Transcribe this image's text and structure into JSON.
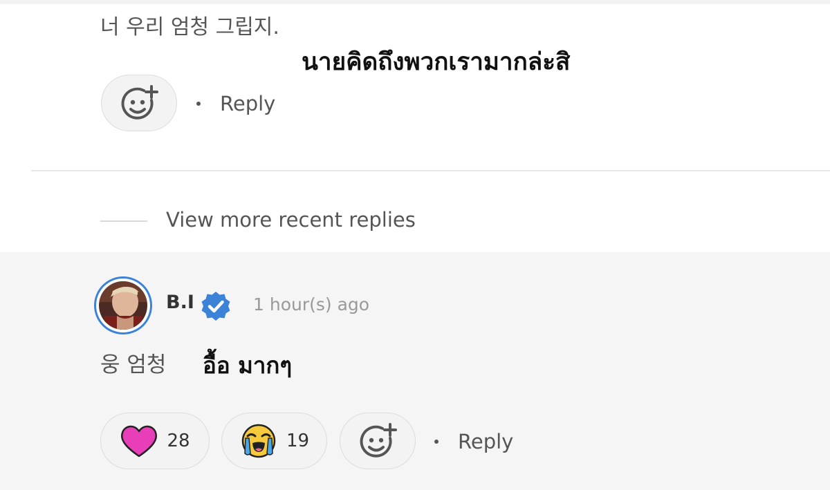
{
  "top_comment": {
    "text": "너 우리 엄청 그립지.",
    "translation": "นายคิดถึงพวกเรามากล่ะสิ",
    "reply_label": "Reply"
  },
  "thread": {
    "view_more_label": "View more recent replies"
  },
  "reply_comment": {
    "username": "B.I",
    "timestamp": "1 hour(s) ago",
    "text": "웅 엄청",
    "translation": "อื้อ มากๆ",
    "reactions": [
      {
        "icon": "heart-icon",
        "count": "28",
        "color": "#e83fb8"
      },
      {
        "icon": "crying-face-icon",
        "count": "19",
        "color": "#f7c93d"
      }
    ],
    "reply_label": "Reply"
  },
  "colors": {
    "accent": "#3c82d6",
    "heart": "#e83fb8",
    "emoji_yellow": "#f7c93d",
    "tear_blue": "#4aa8e6"
  }
}
